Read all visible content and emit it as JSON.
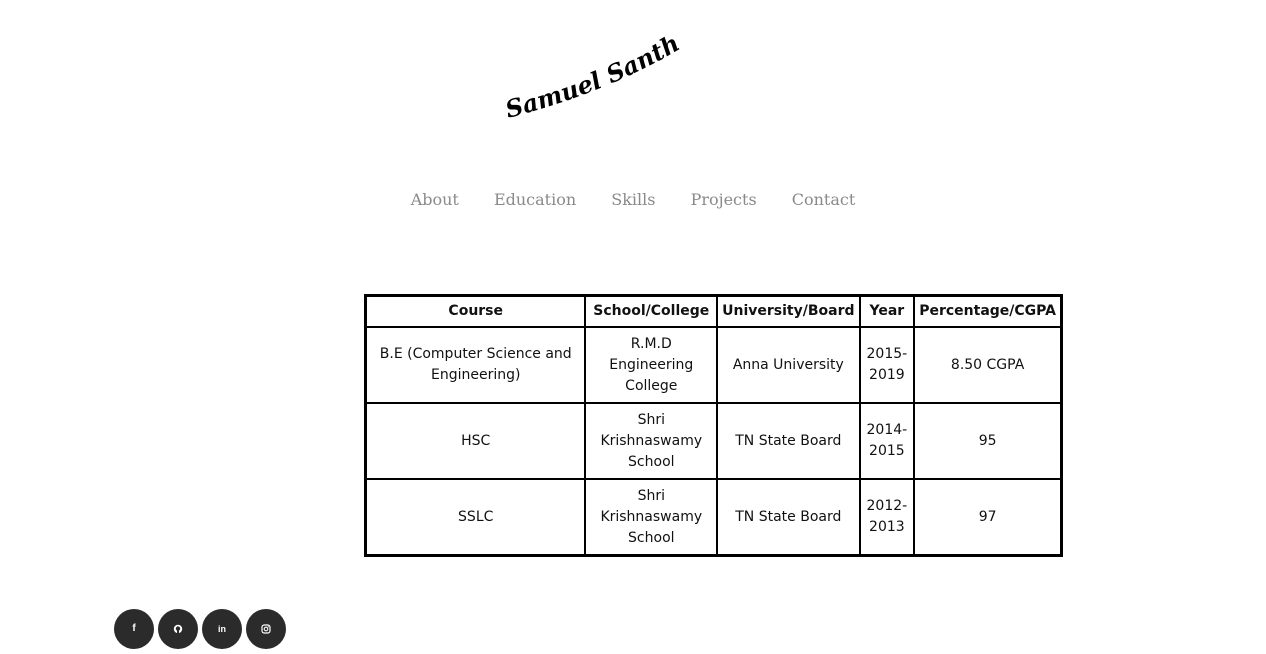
{
  "header": {
    "logo_text": "Samuel Santhosh"
  },
  "nav": {
    "items": [
      {
        "label": "About"
      },
      {
        "label": "Education"
      },
      {
        "label": "Skills"
      },
      {
        "label": "Projects"
      },
      {
        "label": "Contact"
      }
    ]
  },
  "education": {
    "headers": [
      "Course",
      "School/College",
      "University/Board",
      "Year",
      "Percentage/CGPA"
    ],
    "rows": [
      {
        "course": "B.E (Computer Science and Engineering)",
        "school": "R.M.D Engineering College",
        "board": "Anna University",
        "year": "2015-2019",
        "score": "8.50 CGPA"
      },
      {
        "course": "HSC",
        "school": "Shri Krishnaswamy School",
        "board": "TN State Board",
        "year": "2014-2015",
        "score": "95"
      },
      {
        "course": "SSLC",
        "school": "Shri Krishnaswamy School",
        "board": "TN State Board",
        "year": "2012-2013",
        "score": "97"
      }
    ]
  },
  "social": {
    "items": [
      {
        "icon": "facebook-icon",
        "glyph": "f"
      },
      {
        "icon": "github-icon",
        "glyph": ""
      },
      {
        "icon": "linkedin-icon",
        "glyph": "in"
      },
      {
        "icon": "instagram-icon",
        "glyph": ""
      }
    ]
  },
  "colors": {
    "nav_text": "#8a8a8a",
    "social_bg": "#2b2b2b",
    "table_border": "#000000"
  }
}
